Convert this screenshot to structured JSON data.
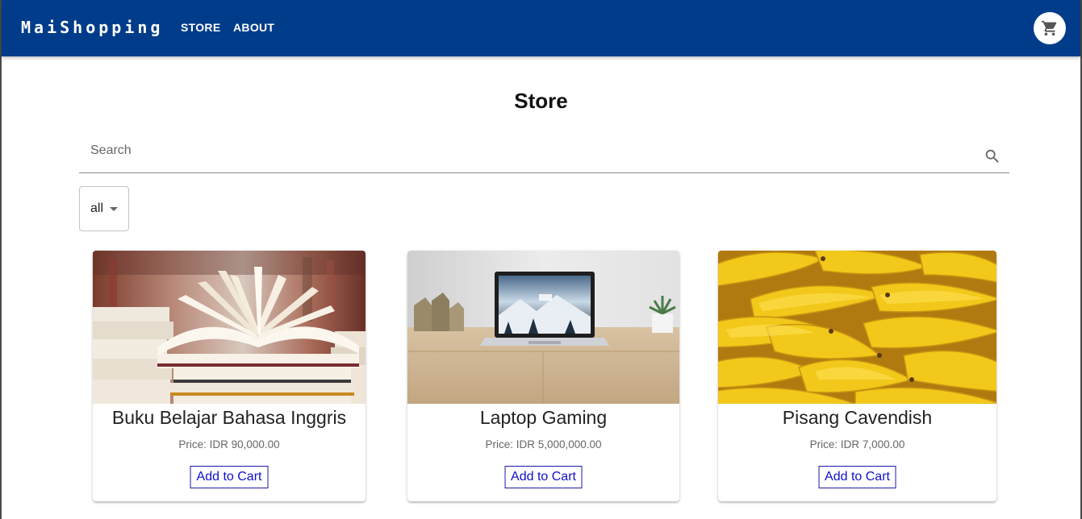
{
  "header": {
    "brand": "MaiShopping",
    "nav": {
      "store": "STORE",
      "about": "ABOUT"
    },
    "cart_icon": "shopping-cart-icon",
    "bar_color": "#003c8a"
  },
  "main": {
    "title": "Store",
    "search": {
      "placeholder": "Search",
      "value": "",
      "icon": "search-icon"
    },
    "filter": {
      "selected": "all"
    }
  },
  "products": [
    {
      "name": "Buku Belajar Bahasa Inggris",
      "price": "Price: IDR 90,000.00",
      "button": "Add to Cart",
      "image": "open-book-photo"
    },
    {
      "name": "Laptop Gaming",
      "price": "Price: IDR 5,000,000.00",
      "button": "Add to Cart",
      "image": "laptop-photo"
    },
    {
      "name": "Pisang Cavendish",
      "price": "Price: IDR 7,000.00",
      "button": "Add to Cart",
      "image": "bananas-photo"
    }
  ]
}
